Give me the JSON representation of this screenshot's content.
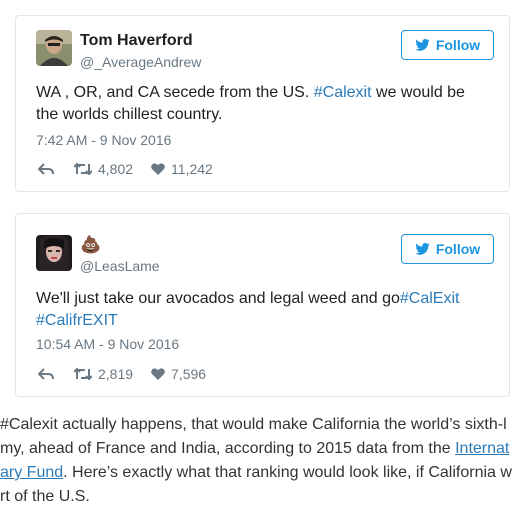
{
  "tweets": [
    {
      "name": "Tom Haverford",
      "handle": "@_AverageAndrew",
      "follow_label": "Follow",
      "text_before": "WA , OR, and CA secede from the US. ",
      "hashtag": "#Calexit",
      "text_after": " we would be the worlds chillest country.",
      "timestamp": "7:42 AM - 9 Nov 2016",
      "retweets": "4,802",
      "likes": "11,242"
    },
    {
      "name": "💩",
      "handle": "@LeasLame",
      "follow_label": "Follow",
      "text_before": "We'll just take our avocados and legal weed and go",
      "hashtag": "#CalExit",
      "hashtag2": "#CalifrEXIT",
      "timestamp": "10:54 AM - 9 Nov 2016",
      "retweets": "2,819",
      "likes": "7,596"
    }
  ],
  "article": {
    "line1": "#Calexit actually happens, that would make California the world’s sixth-l",
    "line2_before": "my, ahead of France and India, according to 2015 data from the ",
    "line2_link": "Internat",
    "line3_link": "ary Fund",
    "line3_after": ". Here’s exactly what that ranking would look like, if California w",
    "line4": "rt of the U.S."
  },
  "colors": {
    "link": "#2b7bb9",
    "follow": "#1b95e0",
    "muted": "#697882"
  }
}
